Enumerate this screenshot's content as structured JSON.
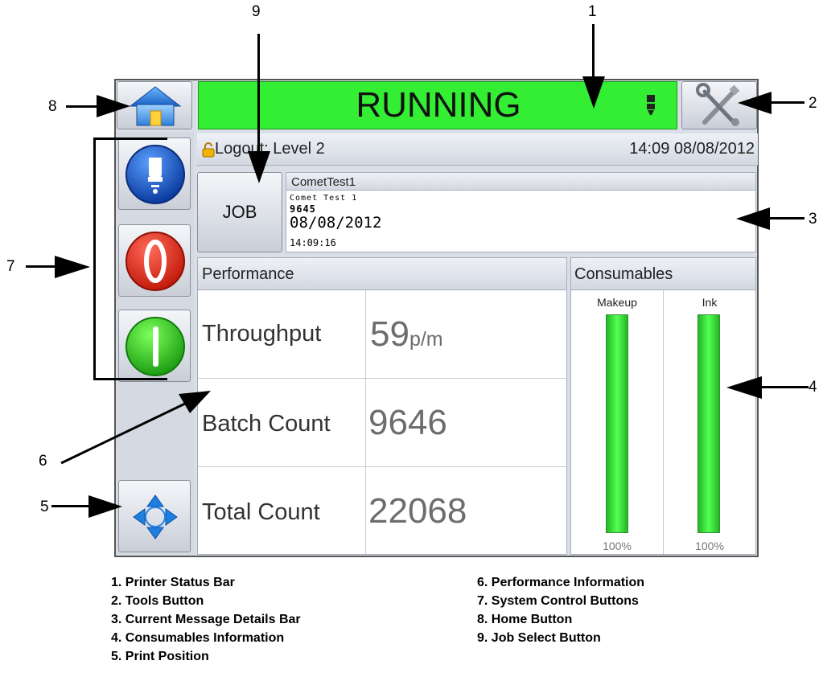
{
  "status": {
    "text": "RUNNING",
    "color": "#33ee33"
  },
  "header": {
    "home_icon": "home-icon",
    "tools_icon": "tools-icon",
    "printhead_icon": "printhead-icon"
  },
  "info_bar": {
    "user": "Logout: Level 2",
    "datetime": "14:09 08/08/2012",
    "lock_icon": "padlock-icon"
  },
  "job": {
    "button_label": "JOB",
    "message_name": "CometTest1",
    "message_lines": [
      "Comet Test 1",
      "9645",
      "08/08/2012",
      "14:09:16"
    ]
  },
  "performance": {
    "title": "Performance",
    "rows": [
      {
        "label": "Throughput",
        "value": "59",
        "unit": "p/m"
      },
      {
        "label": "Batch Count",
        "value": "9646",
        "unit": ""
      },
      {
        "label": "Total Count",
        "value": "22068",
        "unit": ""
      }
    ]
  },
  "consumables": {
    "title": "Consumables",
    "items": [
      {
        "name": "Makeup",
        "level_percent": 100,
        "level_text": "100%"
      },
      {
        "name": "Ink",
        "level_percent": 100,
        "level_text": "100%"
      }
    ],
    "bar_color": "#33dd33"
  },
  "callouts": [
    "1",
    "2",
    "3",
    "4",
    "5",
    "6",
    "7",
    "8",
    "9"
  ],
  "legend": {
    "left": [
      "1. Printer Status Bar",
      "2. Tools Button",
      "3. Current Message Details Bar",
      "4. Consumables Information",
      "5. Print Position"
    ],
    "right": [
      "6. Performance Information",
      "7. System Control Buttons",
      "8. Home Button",
      "9. Job Select Button"
    ]
  }
}
